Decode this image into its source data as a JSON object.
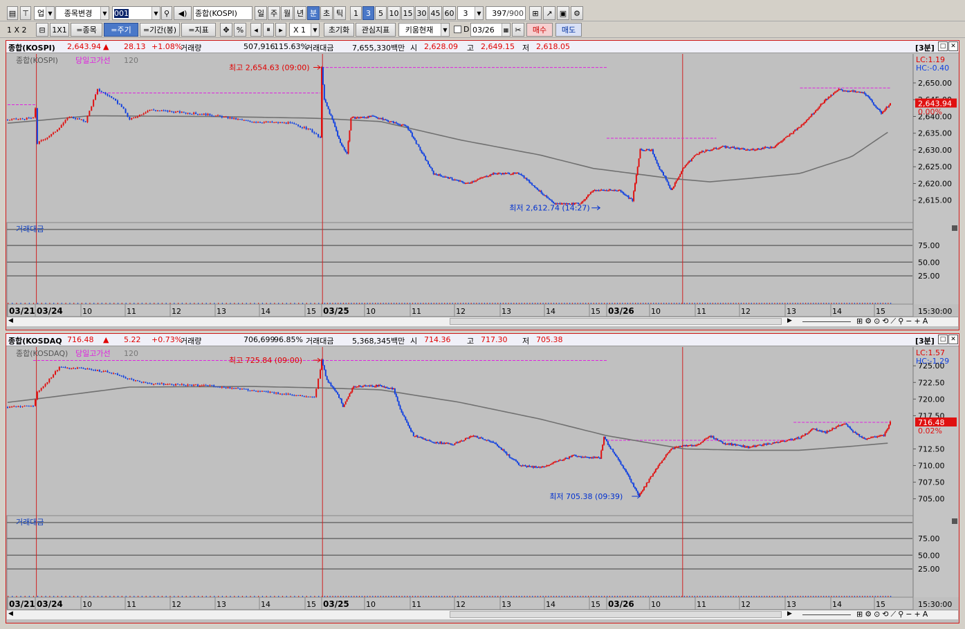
{
  "toolbar1": {
    "market": "업",
    "change_label": "종목변경",
    "code_value": "001",
    "name_value": "종합(KOSPI)",
    "periods": [
      "일",
      "주",
      "월",
      "년",
      "분",
      "초",
      "틱"
    ],
    "active_period": "분",
    "minutes": [
      "1",
      "3",
      "5",
      "10",
      "15",
      "30",
      "45",
      "60"
    ],
    "active_minute": "3",
    "interval_value": "3",
    "count_value": "397",
    "count_total": "/900"
  },
  "toolbar2": {
    "layout": "1 X 2",
    "layout2": "1X1",
    "item_btn": "=종목",
    "period_btn": "=주기",
    "range_btn": "=기간(봉)",
    "indicator_btn": "=지표",
    "percent": "%",
    "zoom": "X 1",
    "reset_btn": "초기화",
    "watch_btn": "관심지표",
    "kiwoom_btn": "키움현재",
    "date_check": "D",
    "date_value": "03/26",
    "buy_btn": "매수",
    "sell_btn": "매도"
  },
  "panels": [
    {
      "id": "kospi",
      "header": {
        "name": "종합(KOSPI)",
        "price": "2,643.94",
        "arrow": "▲",
        "change": "28.13",
        "pct": "+1.08%",
        "vol_label": "거래량",
        "vol": "507,916",
        "vol_pct": "115.63%",
        "amt_label": "거래대금",
        "amt": "7,655,330백만",
        "open_label": "시",
        "open": "2,628.09",
        "high_label": "고",
        "high": "2,649.15",
        "low_label": "저",
        "low": "2,618.05",
        "period_tag": "[3분]"
      },
      "legend": {
        "name": "종합(KOSPI)",
        "line": "당일고가선",
        "ma": "120"
      },
      "lc": "LC:1.19",
      "hc": "HC:-0.40",
      "max_label": "최고 2,654.63 (09:00)",
      "min_label": "최저 2,612.74 (14:27)",
      "price_box": "2,643.94",
      "pct_box": "0.00%",
      "y_ticks": [
        "2,650.00",
        "2,645.00",
        "2,640.00",
        "2,635.00",
        "2,630.00",
        "2,625.00",
        "2,620.00",
        "2,615.00"
      ],
      "y_values": [
        2650,
        2645,
        2640,
        2635,
        2630,
        2625,
        2620,
        2615
      ],
      "sub_title": "거래대금",
      "sub_ticks": [
        "75.00",
        "50.00",
        "25.00"
      ],
      "x_labels": [
        "03/21",
        "03/24",
        "10",
        "11",
        "12",
        "13",
        "14",
        "15",
        "03/25",
        "10",
        "11",
        "12",
        "13",
        "14",
        "15",
        "03/26",
        "10",
        "11",
        "12",
        "13",
        "14",
        "15"
      ],
      "time_label": "15:30:00"
    },
    {
      "id": "kosdaq",
      "header": {
        "name": "종합(KOSDAQ",
        "price": "716.48",
        "arrow": "▲",
        "change": "5.22",
        "pct": "+0.73%",
        "vol_label": "거래량",
        "vol": "706,699",
        "vol_pct": "96.85%",
        "amt_label": "거래대금",
        "amt": "5,368,345백만",
        "open_label": "시",
        "open": "714.36",
        "high_label": "고",
        "high": "717.30",
        "low_label": "저",
        "low": "705.38",
        "period_tag": "[3분]"
      },
      "legend": {
        "name": "종합(KOSDAQ)",
        "line": "당일고가선",
        "ma": "120"
      },
      "lc": "LC:1.57",
      "hc": "HC:-1.29",
      "max_label": "최고 725.84 (09:00)",
      "min_label": "최저 705.38 (09:39)",
      "price_box": "716.48",
      "pct_box": "0.02%",
      "y_ticks": [
        "725.00",
        "722.50",
        "720.00",
        "717.50",
        "712.50",
        "710.00",
        "707.50",
        "705.00"
      ],
      "y_values": [
        725,
        722.5,
        720,
        717.5,
        712.5,
        710,
        707.5,
        705
      ],
      "sub_title": "거래대금",
      "sub_ticks": [
        "75.00",
        "50.00",
        "25.00"
      ],
      "x_labels": [
        "03/21",
        "03/24",
        "10",
        "11",
        "12",
        "13",
        "14",
        "15",
        "03/25",
        "10",
        "11",
        "12",
        "13",
        "14",
        "15",
        "03/26",
        "10",
        "11",
        "12",
        "13",
        "14",
        "15"
      ],
      "time_label": "15:30:00"
    }
  ],
  "colors": {
    "up": "#e01010",
    "down": "#1040e0",
    "ma": "#707070",
    "highline": "#e020e0",
    "panel_border": "#d01818"
  }
}
